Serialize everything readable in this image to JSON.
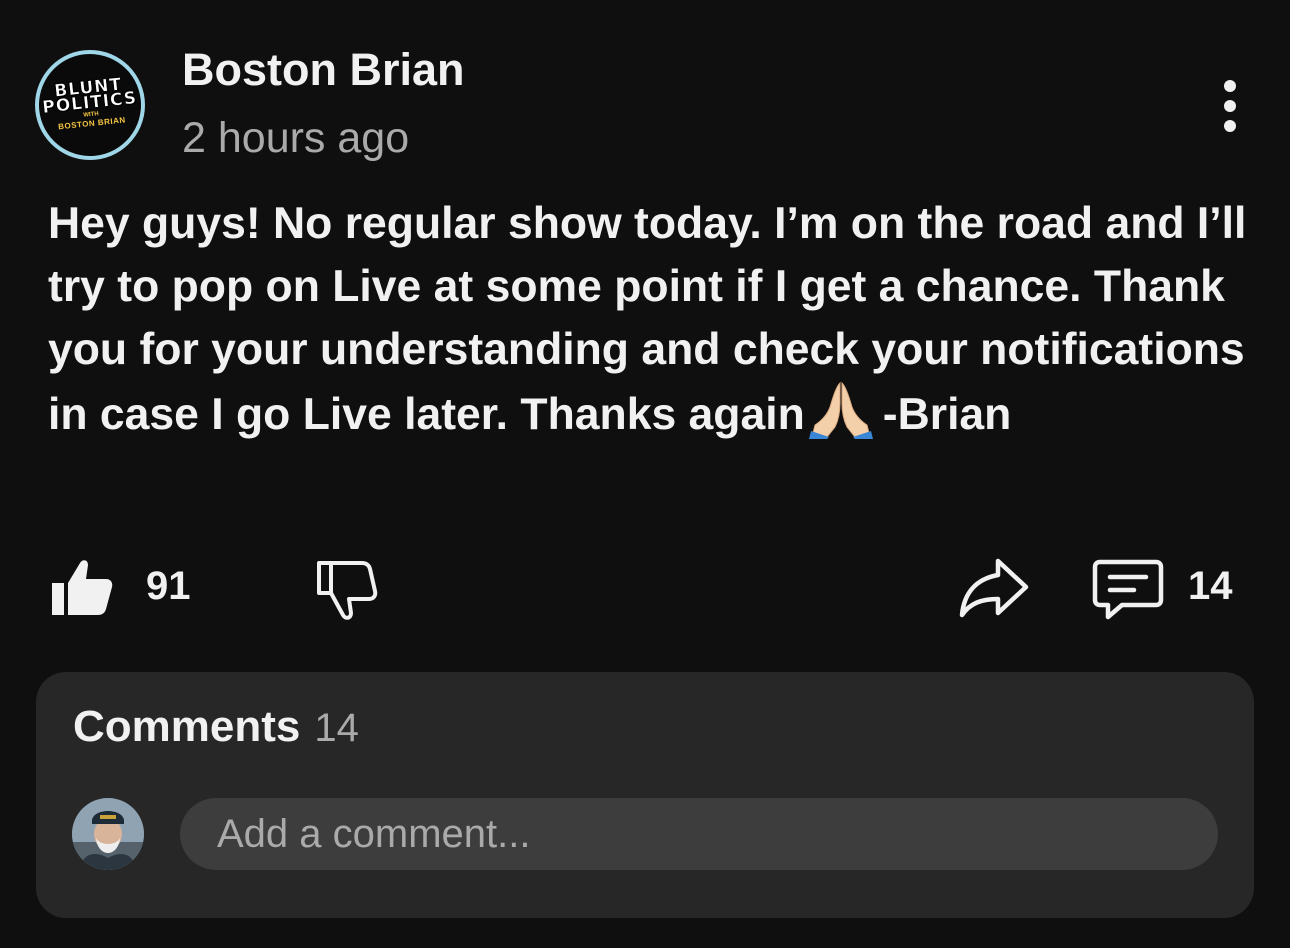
{
  "post": {
    "author": "Boston Brian",
    "timestamp": "2 hours ago",
    "channel_logo": {
      "line1": "BLUNT",
      "line2": "POLITICS",
      "line3": "WITH",
      "line4": "BOSTON BRIAN"
    },
    "body_before_emoji": "Hey guys! No regular show today. I’m on the road and I’ll try to pop on Live at some point if I get a chance. Thank you for your understanding and check your notifications in case I go Live later. Thanks again",
    "body_after_emoji": "-Brian",
    "emoji": "folded-hands-emoji"
  },
  "actions": {
    "like_count": "91",
    "comment_count": "14",
    "icons": [
      "thumbs-up-icon",
      "thumbs-down-icon",
      "share-icon",
      "comment-icon",
      "more-vert-icon"
    ]
  },
  "comments": {
    "title": "Comments",
    "count": "14",
    "placeholder": "Add a comment..."
  },
  "colors": {
    "background": "#0f0f0f",
    "panel": "#272727",
    "input": "#3d3d3d",
    "text": "#f1f1f1",
    "secondary_text": "#aaaaaa",
    "avatar_ring": "#9fd6e8"
  }
}
